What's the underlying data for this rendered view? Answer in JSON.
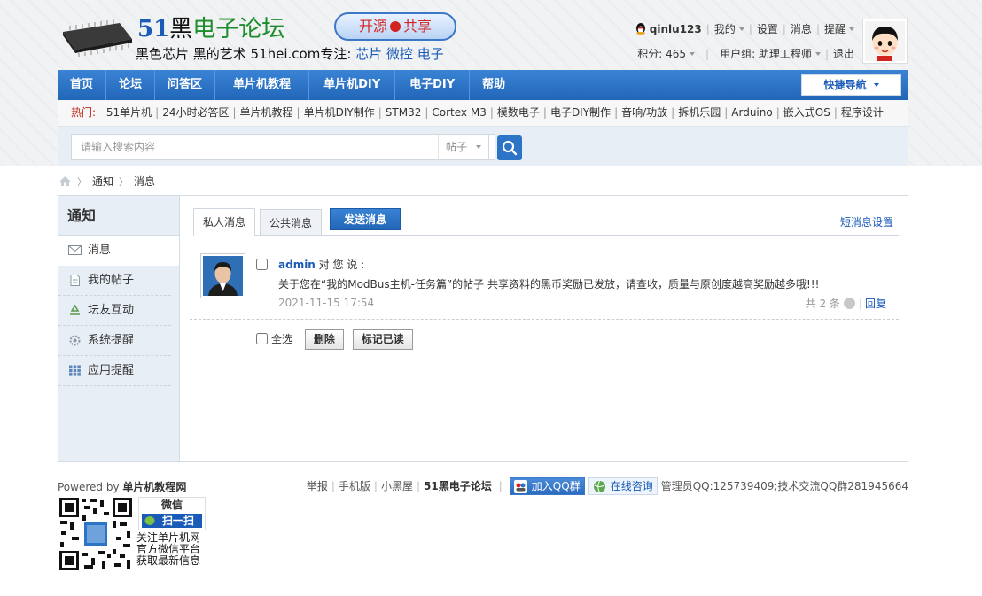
{
  "header": {
    "logo_num": "51",
    "logo_hei": "黑",
    "logo_rest": "电子论坛",
    "slogan_a": "黑色芯片 黑的艺术  51hei.com专注: ",
    "slogan_b": "芯片  微控  电子",
    "badge_left": "开源",
    "badge_right": "共享"
  },
  "user": {
    "name": "qinlu123",
    "links": [
      "我的",
      "设置",
      "消息",
      "提醒"
    ],
    "points": "积分: 465",
    "group": "用户组: 助理工程师",
    "logout": "退出"
  },
  "nav": {
    "items": [
      "首页",
      "论坛",
      "问答区",
      "单片机教程",
      "单片机DIY",
      "电子DIY",
      "帮助"
    ],
    "quick_nav": "快捷导航"
  },
  "hot": {
    "label": "热门:",
    "items": [
      "51单片机",
      "24小时必答区",
      "单片机教程",
      "单片机DIY制作",
      "STM32",
      "Cortex M3",
      "模数电子",
      "电子DIY制作",
      "音响/功放",
      "拆机乐园",
      "Arduino",
      "嵌入式OS",
      "程序设计"
    ]
  },
  "search": {
    "placeholder": "请输入搜索内容",
    "type": "帖子"
  },
  "breadcrumb": [
    "通知",
    "消息"
  ],
  "sidebar": {
    "title": "通知",
    "items": [
      "消息",
      "我的帖子",
      "坛友互动",
      "系统提醒",
      "应用提醒"
    ]
  },
  "tabs": {
    "private": "私人消息",
    "public": "公共消息",
    "send": "发送消息",
    "settings": "短消息设置"
  },
  "message": {
    "author": "admin",
    "says": " 对 您 说 :",
    "body": "关于您在“我的ModBus主机-任务篇”的帖子 共享资料的黑币奖励已发放，请查收，质量与原创度越高奖励越多哦!!!",
    "date": "2021-11-15 17:54",
    "count": "共 2 条",
    "reply": "回复"
  },
  "actions": {
    "select_all": "全选",
    "delete": "删除",
    "mark_read": "标记已读"
  },
  "footer": {
    "powered_prefix": "Powered by ",
    "powered_site": "单片机教程网",
    "links": [
      "举报",
      "手机版",
      "小黑屋"
    ],
    "forum": "51黑电子论坛",
    "qq_group": "加入QQ群",
    "online": "在线咨询",
    "admin_info": "管理员QQ:125739409;技术交流QQ群281945664",
    "wechat_title": "微信",
    "wechat_scan": "扫一扫",
    "wechat_lines": [
      "关注单片机网",
      "官方微信平台",
      "获取最新信息"
    ]
  }
}
